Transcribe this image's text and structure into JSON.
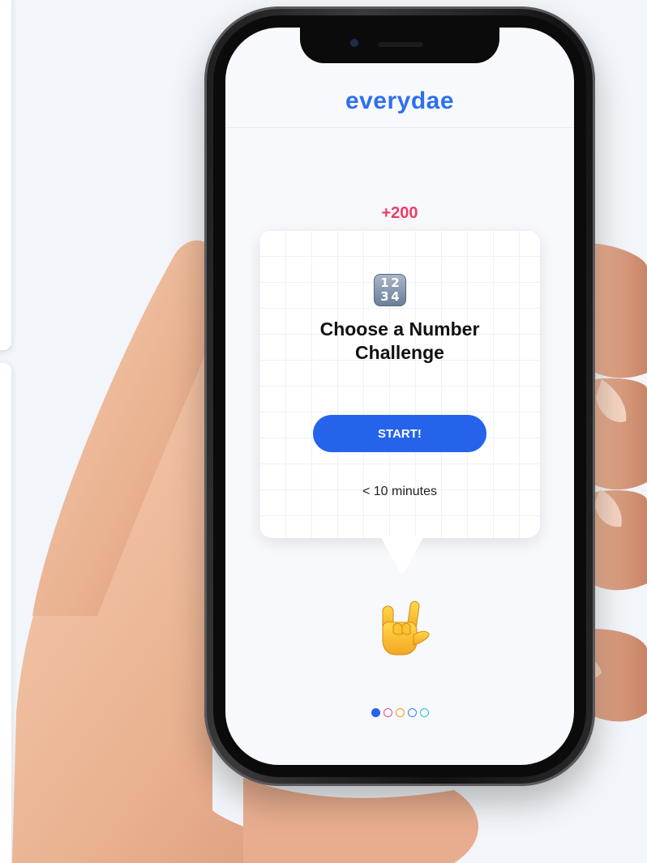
{
  "app": {
    "brand": "everydae"
  },
  "challenge": {
    "points": "+200",
    "icon": "input-numbers-icon",
    "icon_digits": [
      "1",
      "2",
      "3",
      "4"
    ],
    "title_line1": "Choose a Number",
    "title_line2": "Challenge",
    "start_label": "START!",
    "duration": "< 10 minutes"
  },
  "gesture_icon": "love-you-gesture-icon",
  "pagination": {
    "count": 5,
    "active_index": 0,
    "colors": [
      "#2563eb",
      "#ec4899",
      "#f59e0b",
      "#3b82f6",
      "#22c5c5"
    ]
  },
  "colors": {
    "brand": "#2e6ff0",
    "points": "#ee3d63",
    "button": "#2563eb"
  }
}
